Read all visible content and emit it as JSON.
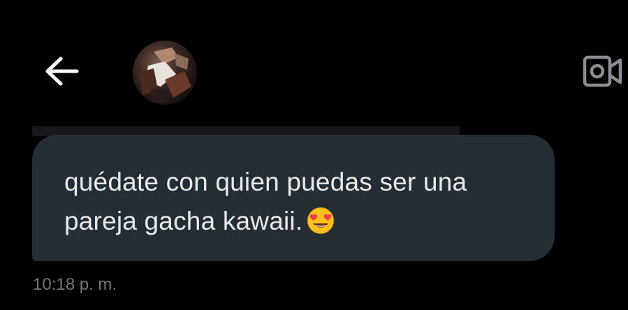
{
  "header": {
    "back_icon": "arrow-left-icon",
    "avatar_icon": "profile-avatar",
    "video_icon": "video-camera-icon"
  },
  "message": {
    "text": "quédate con quien puedas ser una pareja gacha kawaii.",
    "emoji_icon": "heart-eyes-emoji",
    "timestamp": "10:18 p. m."
  },
  "colors": {
    "background": "#000000",
    "bubble": "#252d34",
    "text": "#e7e9ea",
    "muted": "#71767b"
  }
}
